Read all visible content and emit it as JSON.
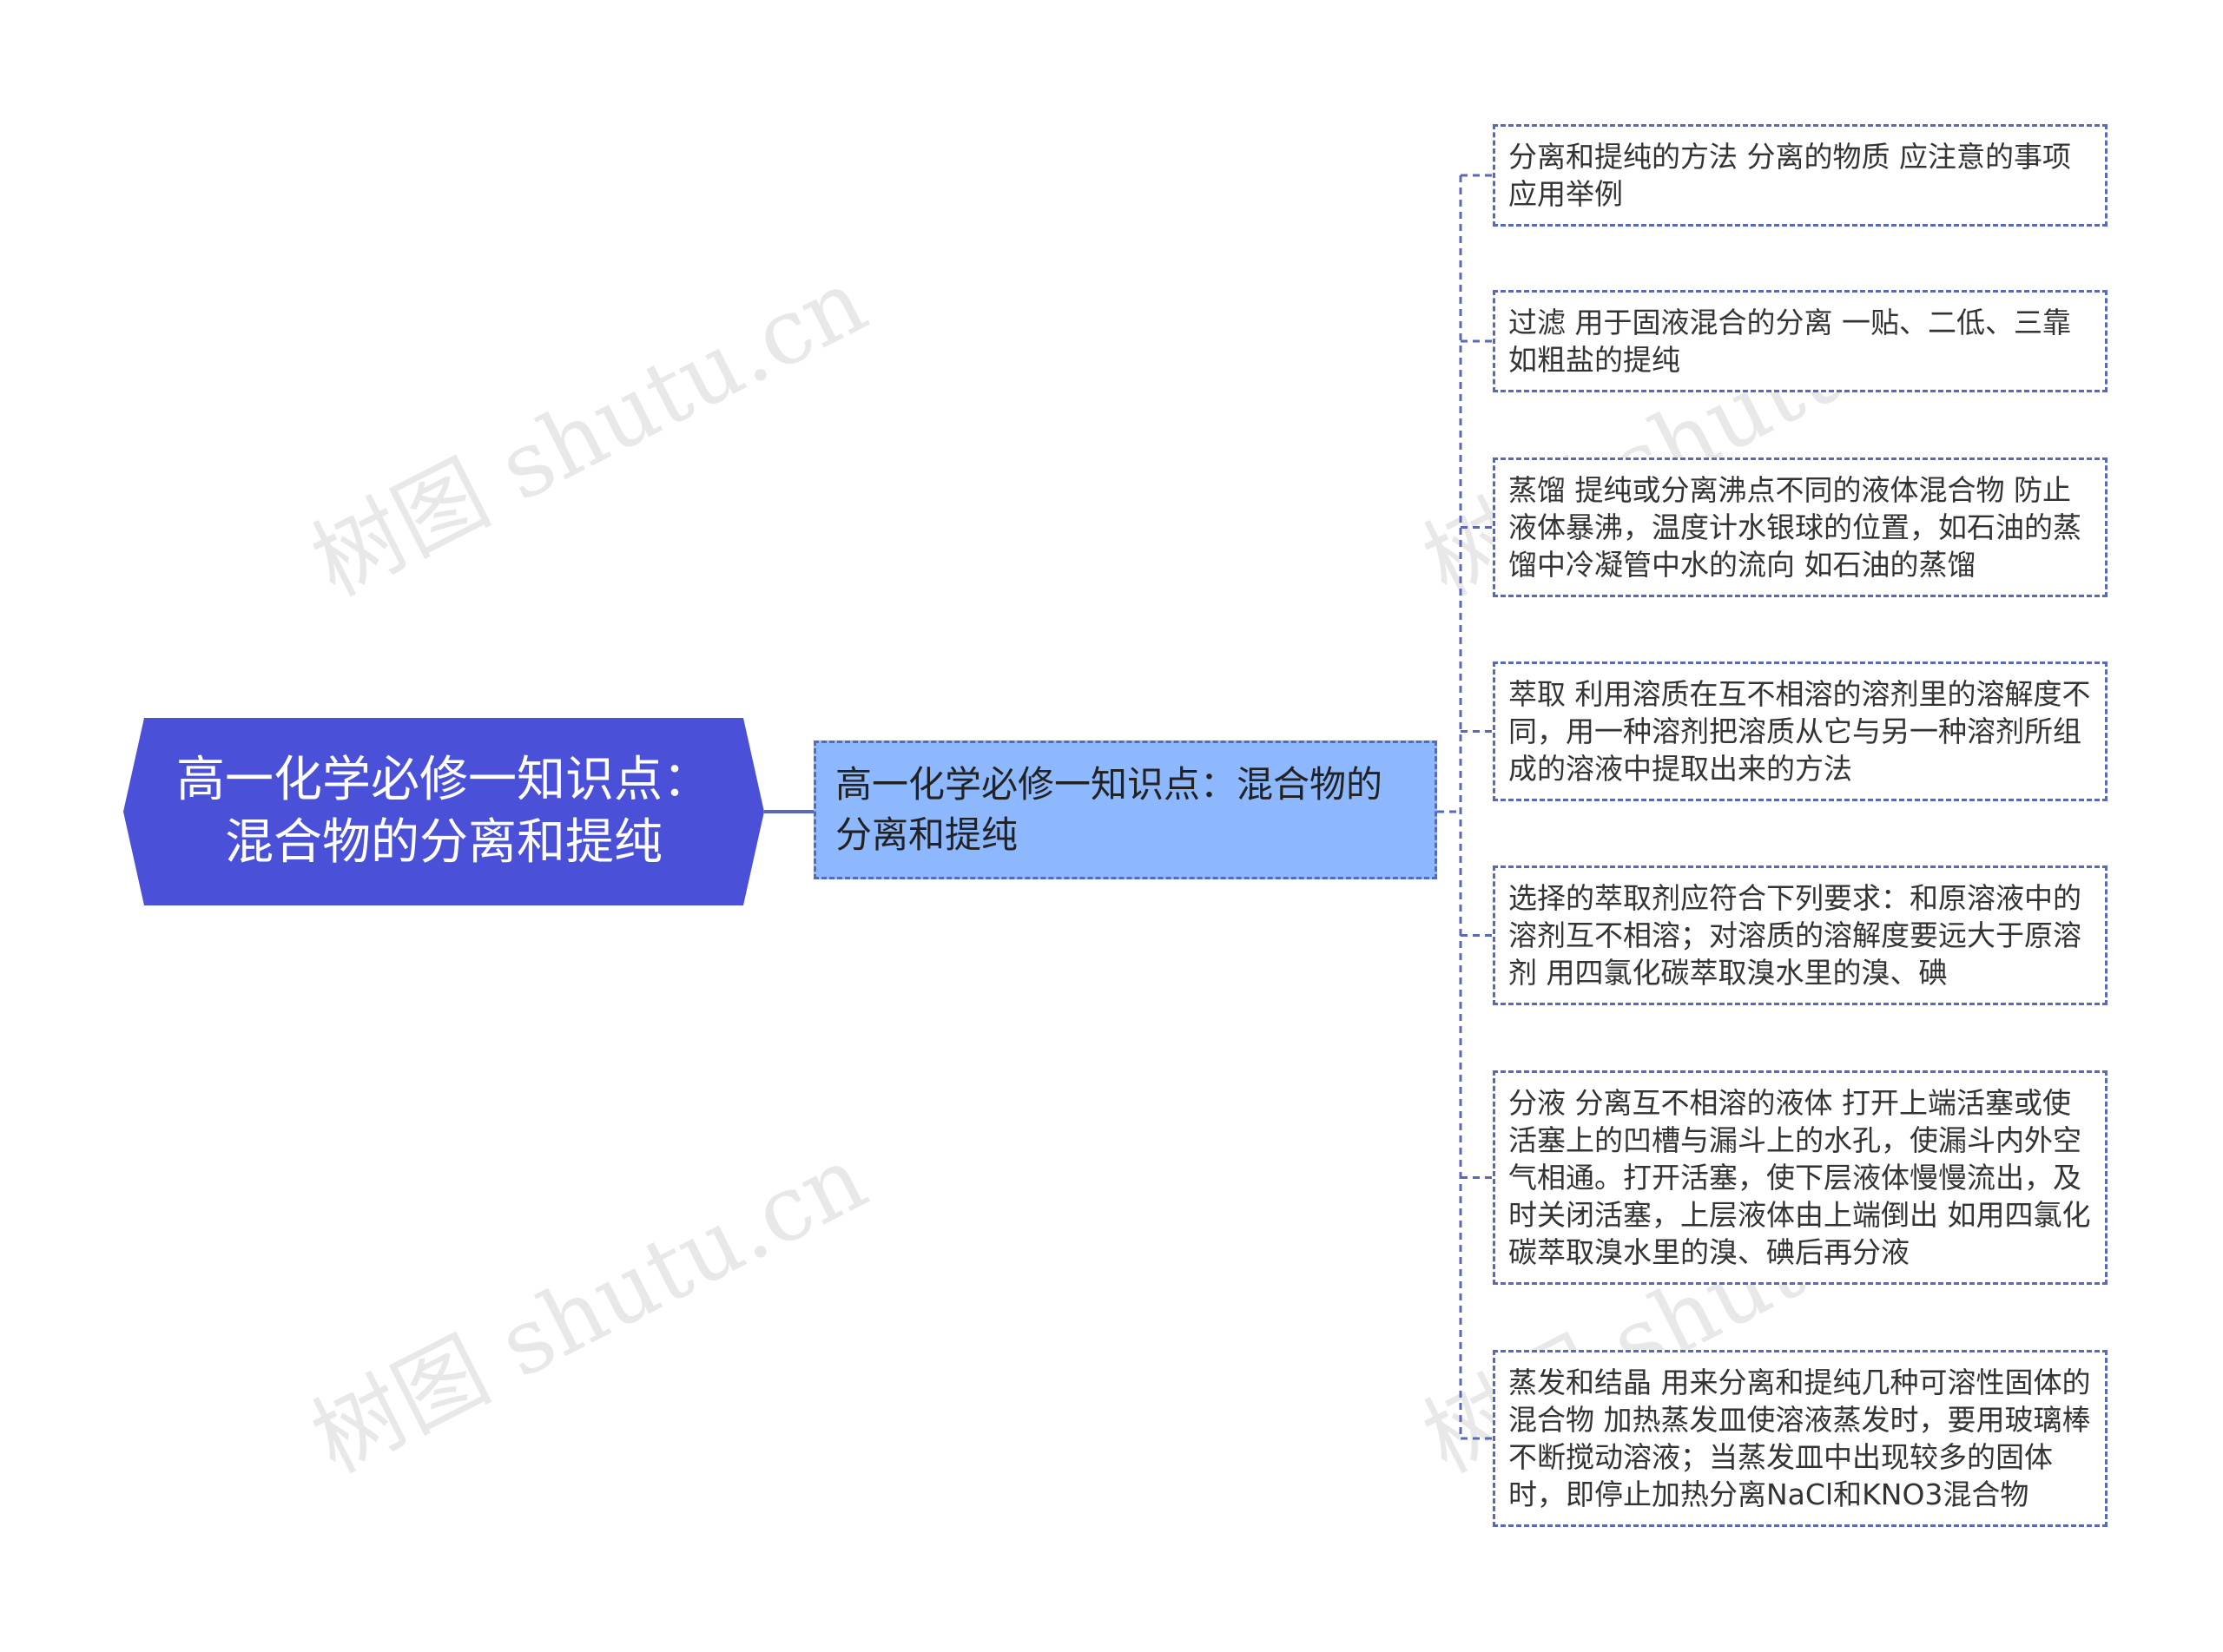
{
  "watermark": "树图 shutu.cn",
  "root": {
    "label": "高一化学必修一知识点：混合物的分离和提纯"
  },
  "sub": {
    "label": "高一化学必修一知识点：混合物的分离和提纯"
  },
  "leaves": [
    "分离和提纯的方法 分离的物质 应注意的事项 应用举例",
    "过滤 用于固液混合的分离 一贴、二低、三靠 如粗盐的提纯",
    "蒸馏 提纯或分离沸点不同的液体混合物 防止液体暴沸，温度计水银球的位置，如石油的蒸馏中冷凝管中水的流向 如石油的蒸馏",
    "萃取 利用溶质在互不相溶的溶剂里的溶解度不同，用一种溶剂把溶质从它与另一种溶剂所组成的溶液中提取出来的方法",
    "选择的萃取剂应符合下列要求：和原溶液中的溶剂互不相溶；对溶质的溶解度要远大于原溶剂 用四氯化碳萃取溴水里的溴、碘",
    "分液 分离互不相溶的液体 打开上端活塞或使活塞上的凹槽与漏斗上的水孔，使漏斗内外空气相通。打开活塞，使下层液体慢慢流出，及时关闭活塞，上层液体由上端倒出 如用四氯化碳萃取溴水里的溴、碘后再分液",
    "蒸发和结晶 用来分离和提纯几种可溶性固体的混合物 加热蒸发皿使溶液蒸发时，要用玻璃棒不断搅动溶液；当蒸发皿中出现较多的固体时，即停止加热分离NaCl和KNO3混合物"
  ],
  "colors": {
    "root": "#4a50d7",
    "sub": "#8db8fd",
    "border": "#5a68b9"
  }
}
